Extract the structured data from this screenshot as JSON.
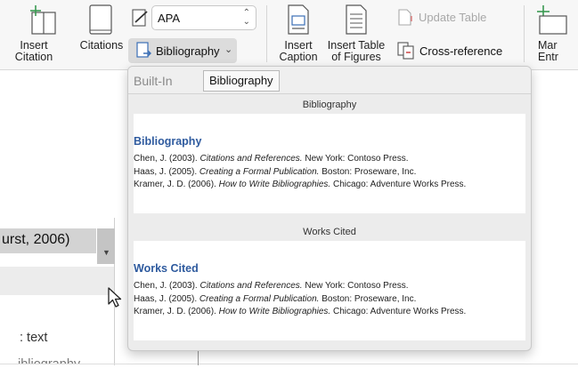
{
  "ribbon": {
    "insert_citation_label_1": "Insert",
    "insert_citation_label_2": "Citation",
    "citations_label": "Citations",
    "style_value": "APA",
    "bibliography_label": "Bibliography",
    "insert_caption_label_1": "Insert",
    "insert_caption_label_2": "Caption",
    "insert_tof_label_1": "Insert Table",
    "insert_tof_label_2": "of Figures",
    "update_table_label": "Update Table",
    "cross_reference_label": "Cross-reference",
    "mark_entry_label_1": "Mar",
    "mark_entry_label_2": "Entr"
  },
  "document": {
    "citation_text": "urst, 2006)",
    "text_1": ": text",
    "text_2": "ibliography"
  },
  "gallery": {
    "header_label": "Built-In",
    "tooltip": "Bibliography",
    "sections": [
      {
        "title": "Bibliography",
        "heading": "Bibliography",
        "entries": [
          {
            "prefix": "Chen, J. (2003). ",
            "title": "Citations and References.",
            "suffix": " New York: Contoso Press."
          },
          {
            "prefix": "Haas, J. (2005). ",
            "title": "Creating a Formal Publication.",
            "suffix": " Boston: Proseware, Inc."
          },
          {
            "prefix": "Kramer, J. D. (2006). ",
            "title": "How to Write Bibliographies.",
            "suffix": " Chicago: Adventure Works Press."
          }
        ]
      },
      {
        "title": "Works Cited",
        "heading": "Works Cited",
        "entries": [
          {
            "prefix": "Chen, J. (2003). ",
            "title": "Citations and References.",
            "suffix": " New York: Contoso Press."
          },
          {
            "prefix": "Haas, J. (2005). ",
            "title": "Creating a Formal Publication.",
            "suffix": " Boston: Proseware, Inc."
          },
          {
            "prefix": "Kramer, J. D. (2006). ",
            "title": "How to Write Bibliographies.",
            "suffix": " Chicago: Adventure Works Press."
          }
        ]
      }
    ]
  },
  "colors": {
    "heading_blue": "#2e5a9e",
    "ribbon_bg": "#f7f7f7",
    "icon_green": "#3a9a52"
  }
}
